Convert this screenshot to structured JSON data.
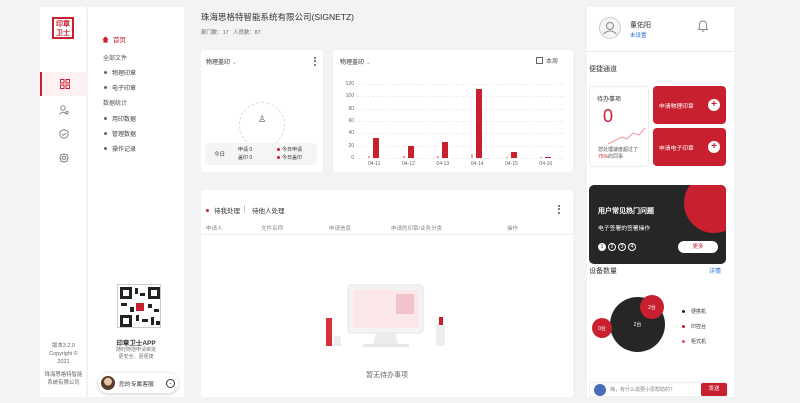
{
  "rail": {
    "logo_text": "印章\n卫士",
    "icons": [
      "grid-icon",
      "user-settings-icon",
      "shield-icon",
      "gear-icon"
    ],
    "version": "版本3.2.0",
    "copyright": "Copyright ©",
    "year": "2021",
    "company_line1": "珠海思格特智能",
    "company_line2": "系统有限公司"
  },
  "subnav": {
    "home": "首页",
    "group_files": "全部文件",
    "items_files": [
      "物理印章",
      "电子印章"
    ],
    "group_stats": "数据统计",
    "items_stats": [
      "用印数据",
      "管理数据",
      "操作记录"
    ],
    "app_title": "印章卫士APP",
    "app_sub1": "随时随地申请审批",
    "app_sub2": "更安全、更便捷",
    "consultant": "您的专属客服"
  },
  "header": {
    "company": "珠海思格特智能系统有限公司(SIGNETZ)",
    "dept_label": "部门数：",
    "dept_count": "17",
    "people_label": "人员数：",
    "people_count": "87"
  },
  "seal_card": {
    "title": "物理盖印",
    "today_label": "今日",
    "apply_label": "申请",
    "apply_value": "0",
    "seal_label": "盖印",
    "seal_value": "0",
    "legend_apply": "今日申请",
    "legend_seal": "今日盖印"
  },
  "chart_card": {
    "title": "物理盖印",
    "period": "本周"
  },
  "chart_data": {
    "type": "bar",
    "categories": [
      "04-11",
      "04-12",
      "04-13",
      "04-14",
      "04-15",
      "04-16"
    ],
    "series": [
      {
        "values": [
          4,
          3,
          3,
          6,
          2,
          2
        ]
      },
      {
        "values": [
          32,
          20,
          26,
          112,
          10,
          2
        ]
      }
    ],
    "ylim": [
      0,
      120
    ],
    "yticks": [
      0,
      20,
      40,
      60,
      80,
      100,
      120
    ]
  },
  "tasks": {
    "tab_mine": "待我处理",
    "tab_others": "待他人处理",
    "columns": [
      "申请人",
      "文件名称",
      "申请信息",
      "申请的印章/业务分类",
      "操作"
    ],
    "empty": "暂无待办事项"
  },
  "right": {
    "user_name": "董佑阳",
    "user_status": "未设置",
    "shortcuts_title": "便捷通道",
    "todo_label": "待办事项",
    "todo_count": "0",
    "todo_desc1": "您处理速度超过了",
    "todo_pct": "75%",
    "todo_desc2": "的同事",
    "apply_physical": "申请物理印章",
    "apply_electronic": "申请电子印章",
    "faq_title": "用户常见热门问题",
    "faq_question": "电子签署的签署操作",
    "faq_pages": [
      "1",
      "2",
      "3",
      "4"
    ],
    "faq_more": "更多",
    "devices_title": "设备数量",
    "devices_detail": "详情",
    "device_bubbles": [
      "2台",
      "2台",
      "0台"
    ],
    "device_legend": [
      "便携机",
      "印控台",
      "柜式机"
    ],
    "chat_placeholder": "嗨，有什么需要小思帮助的？",
    "chat_send": "发送"
  },
  "colors": {
    "accent": "#c8202f",
    "dark": "#262626"
  }
}
